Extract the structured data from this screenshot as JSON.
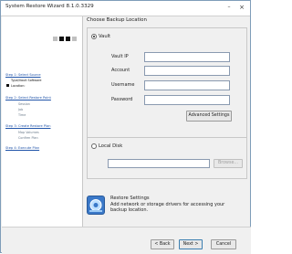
{
  "window": {
    "title": "System Restore Wizard 8.1.0.3329"
  },
  "sidebar": {
    "steps": [
      {
        "label": "Step 1: Select Source",
        "subitems": [
          "Type/Vault Software",
          "Location:"
        ]
      },
      {
        "label": "Step 2: Select Restore Point",
        "subitems": [
          "Session",
          "Job",
          "Time"
        ]
      },
      {
        "label": "Step 3: Create Restore Plan",
        "subitems": [
          "Map Volumes",
          "Confirm Plan"
        ]
      },
      {
        "label": "Step 4: Execute Plan",
        "subitems": []
      }
    ]
  },
  "main": {
    "header": "Choose Backup Location",
    "vault": {
      "radio_label": "Vault",
      "selected": true,
      "fields": [
        {
          "label": "Vault IP",
          "value": ""
        },
        {
          "label": "Account",
          "value": ""
        },
        {
          "label": "Username",
          "value": ""
        },
        {
          "label": "Password",
          "value": ""
        }
      ],
      "advanced_button": "Advanced Settings"
    },
    "local": {
      "radio_label": "Local Disk",
      "selected": false,
      "path_value": "",
      "browse_button": "Browse..."
    },
    "info": {
      "icon": "restore-settings-icon",
      "title": "Restore Settings",
      "description": "Add network or storage drivers for accessing your backup location."
    }
  },
  "footer": {
    "back_button": "< Back",
    "next_button": "Next >",
    "cancel_button": "Cancel"
  },
  "colors": {
    "link": "#2255aa",
    "window_bg": "#f0f0f0",
    "sidebar_bg": "#ffffff",
    "icon_blue": "#3a78c8"
  }
}
